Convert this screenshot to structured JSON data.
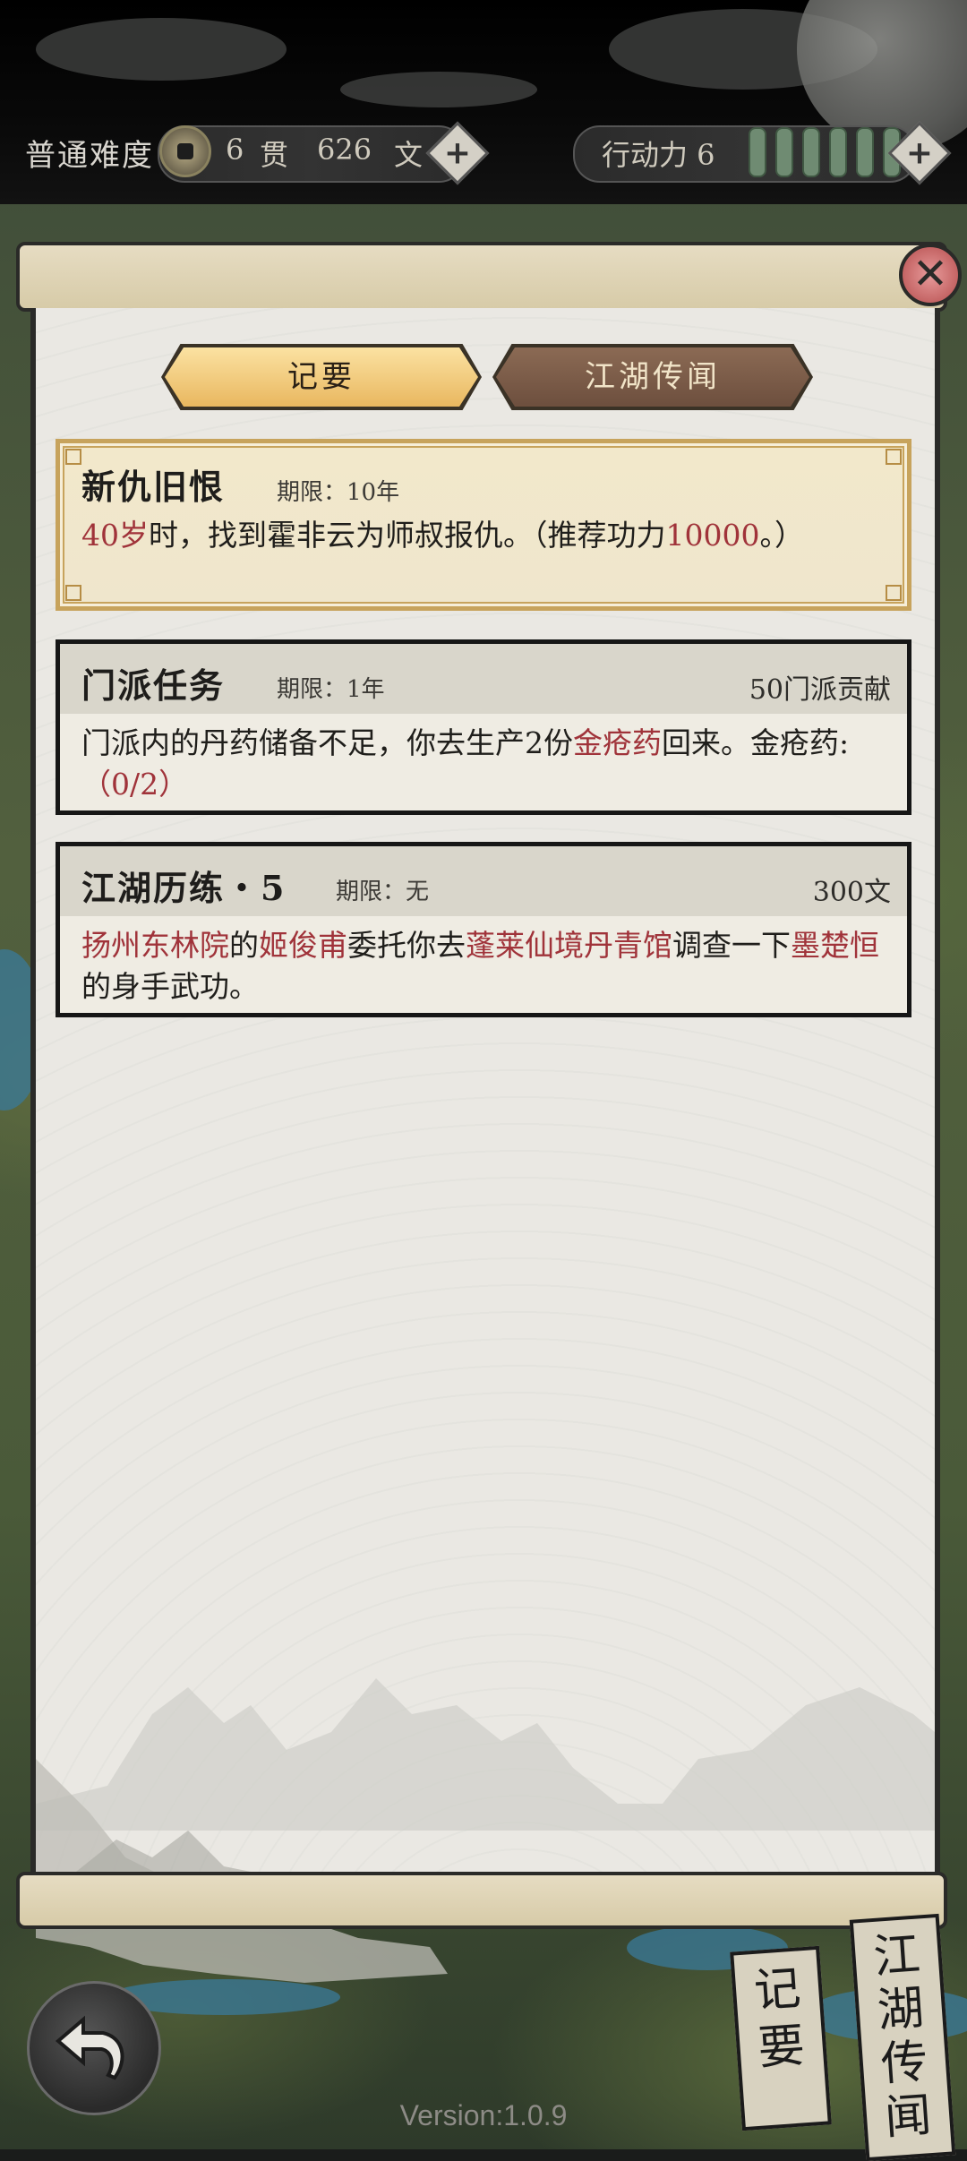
{
  "topbar": {
    "difficulty": "普通难度",
    "money_guan": "6",
    "money_guan_unit": "贯",
    "money_wen": "626",
    "money_wen_unit": "文",
    "plus": "+",
    "stamina_label": "行动力 6",
    "stamina_bars": 6
  },
  "tabs": {
    "active": "记要",
    "inactive": "江湖传闻"
  },
  "close_symbol": "✕",
  "quests": [
    {
      "title": "新仇旧恨",
      "deadline": "期限：10年",
      "body_parts": [
        "40岁",
        "时，找到霍非云为师叔报仇。（推荐功力",
        "10000",
        "。）"
      ]
    },
    {
      "title": "门派任务",
      "deadline": "期限：1年",
      "reward": "50门派贡献",
      "body_parts": [
        "门派内的丹药储备不足，你去生产2份",
        "金疮药",
        "回来。金疮药:",
        "（0/2）"
      ]
    },
    {
      "title": "江湖历练・5",
      "deadline": "期限：无",
      "reward": "300文",
      "body_parts": [
        "扬州东林院",
        "的",
        "姬俊甫",
        "委托你去",
        "蓬莱仙境丹青馆",
        "调查一下",
        "墨楚恒",
        "的身手武功。"
      ]
    }
  ],
  "bottom": {
    "side_tab_notes": "记要",
    "side_tab_rumors": "江湖传闻",
    "version": "Version:1.0.9"
  },
  "colors": {
    "highlight": "#a0333a",
    "tab_active": "#e9b75f",
    "tab_inactive": "#6d4f3e",
    "stamina": "#6f8b72"
  },
  "icons": [
    "coin-icon",
    "plus-icon",
    "close-icon",
    "back-arrow-icon",
    "mountain-ink-painting"
  ]
}
